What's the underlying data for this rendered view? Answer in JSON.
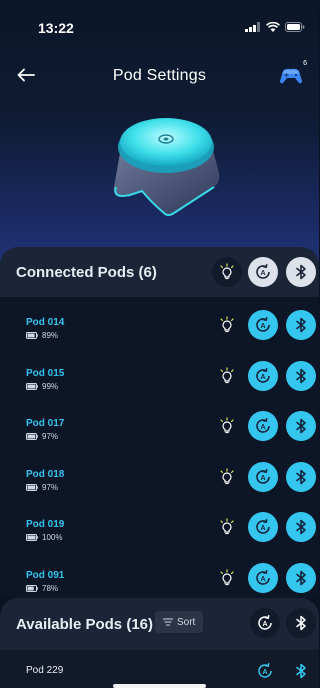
{
  "status_bar": {
    "time": "13:22"
  },
  "nav": {
    "title": "Pod Settings",
    "controller_badge": "6"
  },
  "connected": {
    "title": "Connected Pods (6)",
    "pods": [
      {
        "name": "Pod 014",
        "battery": "89%",
        "battery_level": 0.89
      },
      {
        "name": "Pod 015",
        "battery": "99%",
        "battery_level": 0.99
      },
      {
        "name": "Pod 017",
        "battery": "97%",
        "battery_level": 0.97
      },
      {
        "name": "Pod 018",
        "battery": "97%",
        "battery_level": 0.97
      },
      {
        "name": "Pod 019",
        "battery": "100%",
        "battery_level": 1.0
      },
      {
        "name": "Pod 091",
        "battery": "78%",
        "battery_level": 0.78
      }
    ]
  },
  "available": {
    "title": "Available Pods (16)",
    "sort_label": "Sort",
    "pods": [
      {
        "name": "Pod 229"
      }
    ]
  },
  "colors": {
    "accent": "#35c6f0",
    "background": "#0b1322",
    "header": "#1b2537"
  },
  "icons": {
    "back": "arrow-left-icon",
    "controller": "gamepad-icon",
    "light": "lightbulb-icon",
    "auto": "auto-cycle-icon",
    "bluetooth": "bluetooth-icon",
    "sort": "sort-lines-icon"
  }
}
